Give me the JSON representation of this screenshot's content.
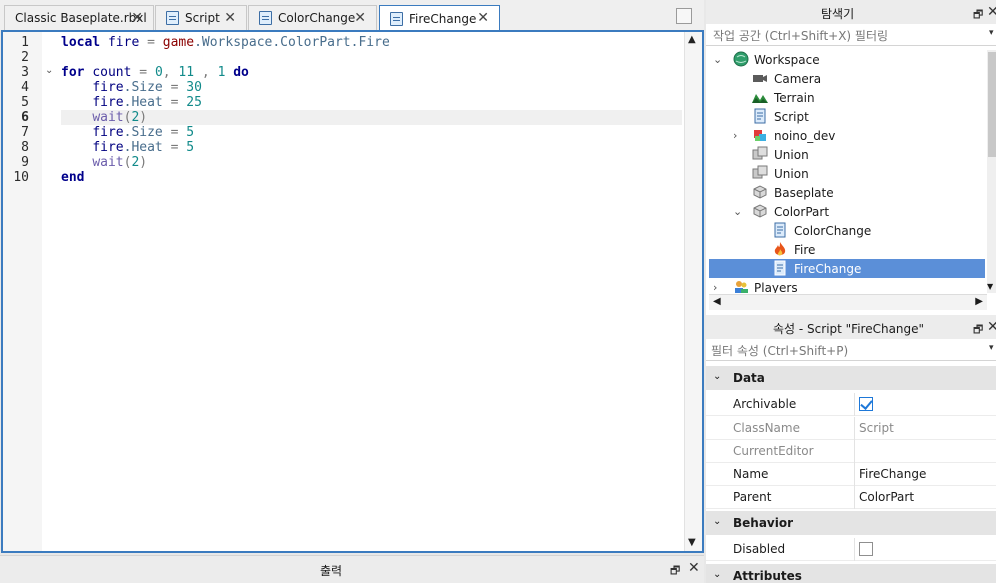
{
  "tabs": [
    {
      "label": "Classic Baseplate.rbxl",
      "close": "✕",
      "icon": "none"
    },
    {
      "label": "Script",
      "close": "✕",
      "icon": "script-icon"
    },
    {
      "label": "ColorChange",
      "close": "✕",
      "icon": "script-icon"
    },
    {
      "label": "FireChange",
      "close": "✕",
      "icon": "script-icon",
      "active": true
    }
  ],
  "editor": {
    "line_numbers": [
      "1",
      "2",
      "3",
      "4",
      "5",
      "6",
      "7",
      "8",
      "9",
      "10"
    ],
    "current_line": "6",
    "code": {
      "l1": {
        "kw": "local",
        "name": "fire",
        "eq": "=",
        "game": "game",
        "p1": ".Workspace",
        "p2": ".ColorPart",
        "p3": ".Fire"
      },
      "l3": {
        "kw": "for",
        "var": "count",
        "eq": "=",
        "n1": "0",
        "c1": ",",
        "n2": "11",
        "c2": " ,",
        "n3": "1",
        "do": "do"
      },
      "l4": {
        "obj": "fire",
        "prop": ".Size",
        "eq": "=",
        "num": "30"
      },
      "l5": {
        "obj": "fire",
        "prop": ".Heat",
        "eq": "=",
        "num": "25"
      },
      "l6": {
        "fn": "wait",
        "op": "(",
        "num": "2",
        "cp": ")"
      },
      "l7": {
        "obj": "fire",
        "prop": ".Size",
        "eq": "=",
        "num": "5"
      },
      "l8": {
        "obj": "fire",
        "prop": ".Heat",
        "eq": "=",
        "num": "5"
      },
      "l9": {
        "fn": "wait",
        "op": "(",
        "num": "2",
        "cp": ")"
      },
      "l10": {
        "kw": "end"
      }
    }
  },
  "output": {
    "title": "출력"
  },
  "explorer": {
    "title": "탐색기",
    "filter_placeholder": "작업 공간 (Ctrl+Shift+X) 필터링",
    "tree": [
      {
        "label": "Workspace",
        "icon": "workspace-globe-icon",
        "expanded": true
      },
      {
        "label": "Camera",
        "icon": "camera-icon"
      },
      {
        "label": "Terrain",
        "icon": "terrain-icon"
      },
      {
        "label": "Script",
        "icon": "script-icon"
      },
      {
        "label": "noino_dev",
        "icon": "model-icon",
        "collapsed": true
      },
      {
        "label": "Union",
        "icon": "union-icon"
      },
      {
        "label": "Union",
        "icon": "union-icon"
      },
      {
        "label": "Baseplate",
        "icon": "part-icon"
      },
      {
        "label": "ColorPart",
        "icon": "part-icon",
        "expanded": true
      },
      {
        "label": "ColorChange",
        "icon": "script-icon"
      },
      {
        "label": "Fire",
        "icon": "fire-icon"
      },
      {
        "label": "FireChange",
        "icon": "script-icon",
        "selected": true
      },
      {
        "label": "Players",
        "icon": "players-icon",
        "collapsed": true
      }
    ]
  },
  "properties": {
    "title": "속성 - Script \"FireChange\"",
    "filter_placeholder": "필터 속성 (Ctrl+Shift+P)",
    "categories": {
      "data": "Data",
      "behavior": "Behavior",
      "attributes": "Attributes"
    },
    "rows": {
      "archivable": {
        "name": "Archivable",
        "checked": true
      },
      "classname": {
        "name": "ClassName",
        "value": "Script"
      },
      "currenteditor": {
        "name": "CurrentEditor",
        "value": ""
      },
      "name": {
        "name": "Name",
        "value": "FireChange"
      },
      "parent": {
        "name": "Parent",
        "value": "ColorPart"
      },
      "disabled": {
        "name": "Disabled",
        "checked": false
      }
    }
  },
  "colors": {
    "accent": "#3b7bbf",
    "selection": "#5b8fd8",
    "keyword": "#00008b",
    "number": "#118a8a"
  }
}
